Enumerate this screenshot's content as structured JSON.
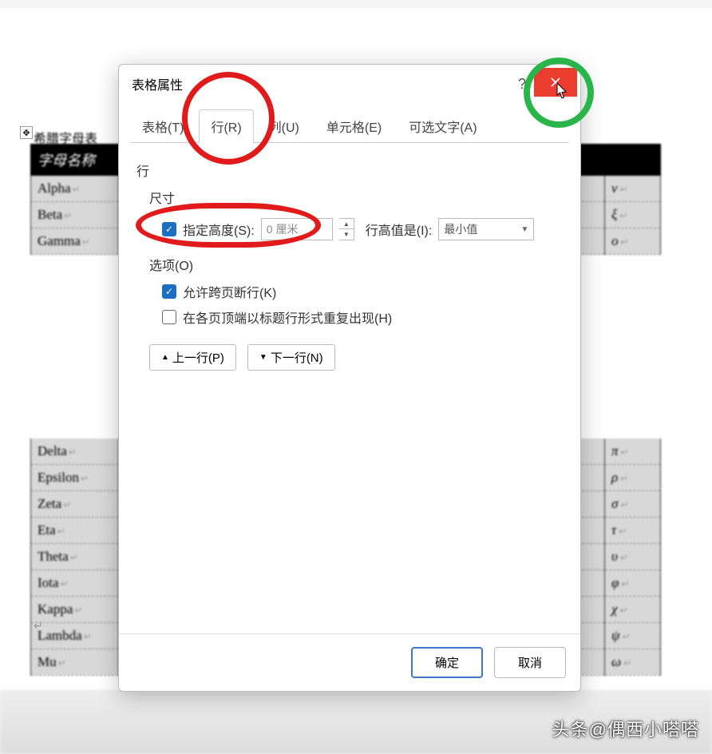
{
  "document": {
    "title": "希腊字母表",
    "end_paragraph": "↵",
    "header_col1": "字母名称",
    "header_col2": "",
    "rows_top": [
      {
        "name": "Alpha",
        "sym": "ν"
      },
      {
        "name": "Beta",
        "sym": "ξ"
      },
      {
        "name": "Gamma",
        "sym": "ο"
      }
    ],
    "rows_bottom": [
      {
        "name": "Delta",
        "sym": "π"
      },
      {
        "name": "Epsilon",
        "sym": "ρ"
      },
      {
        "name": "Zeta",
        "sym": "σ"
      },
      {
        "name": "Eta",
        "sym": "τ"
      },
      {
        "name": "Theta",
        "sym": "υ"
      },
      {
        "name": "Iota",
        "sym": "φ"
      },
      {
        "name": "Kappa",
        "sym": "χ"
      },
      {
        "name": "Lambda",
        "sym": "ψ"
      },
      {
        "name": "Mu",
        "sym": "ω"
      }
    ]
  },
  "dialog": {
    "title": "表格属性",
    "help": "?",
    "tabs": {
      "table": "表格(T)",
      "row": "行(R)",
      "column": "列(U)",
      "cell": "单元格(E)",
      "alt": "可选文字(A)"
    },
    "row_section": "行",
    "size_section": "尺寸",
    "specify_height": "指定高度(S):",
    "height_value": "0 厘米",
    "height_is_label": "行高值是(I):",
    "height_is_value": "最小值",
    "options_section": "选项(O)",
    "allow_break": "允许跨页断行(K)",
    "repeat_header": "在各页顶端以标题行形式重复出现(H)",
    "prev_row": "上一行(P)",
    "next_row": "下一行(N)",
    "ok": "确定",
    "cancel": "取消"
  },
  "watermark": "头条@偶西小嗒嗒"
}
